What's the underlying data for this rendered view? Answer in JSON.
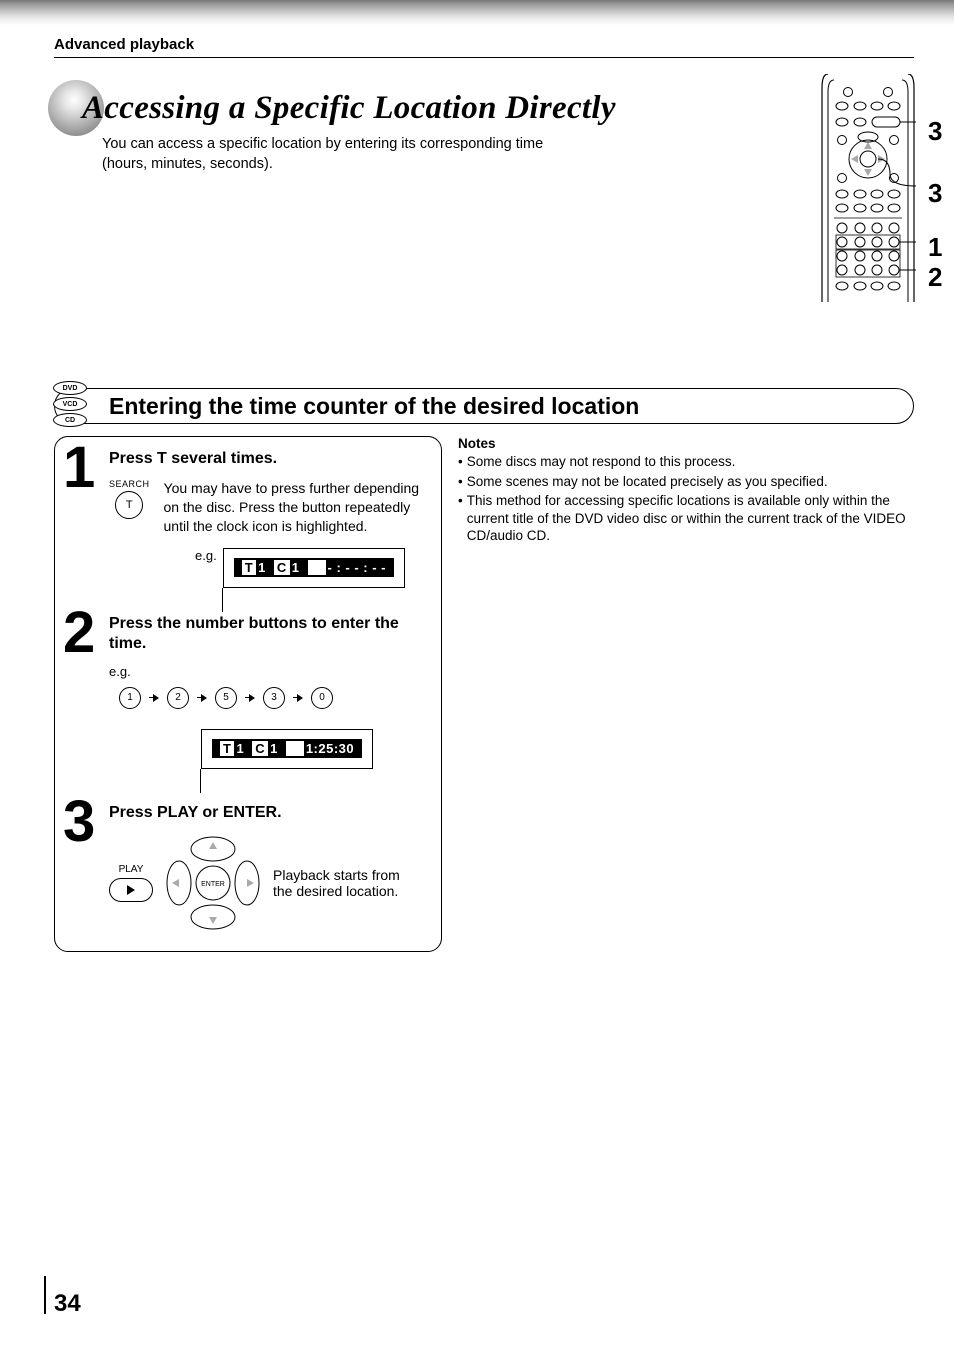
{
  "breadcrumb": "Advanced playback",
  "title": "Accessing a Specific Location Directly",
  "subtitle": "You can access a specific location by entering its corresponding time (hours, minutes, seconds).",
  "remote": {
    "callout_3a": "3",
    "callout_3b": "3",
    "callout_1": "1",
    "callout_2": "2"
  },
  "media": {
    "dvd": "DVD",
    "vcd": "VCD",
    "cd": "CD"
  },
  "section_title": "Entering the time counter of the desired location",
  "eg_label": "e.g.",
  "steps": {
    "s1": {
      "num": "1",
      "title": "Press T several times.",
      "search_label": "SEARCH",
      "t_label": "T",
      "body": "You may have to press further depending on the disc. Press the button repeatedly until the clock icon is highlighted.",
      "osd": {
        "T": "T",
        "Tn": "1",
        "C": "C",
        "Cn": "1",
        "time": "- : - - : - -"
      }
    },
    "s2": {
      "num": "2",
      "title": "Press the number buttons to enter the time.",
      "nums": [
        "1",
        "2",
        "5",
        "3",
        "0"
      ],
      "osd": {
        "T": "T",
        "Tn": "1",
        "C": "C",
        "Cn": "1",
        "time": "1:25:30"
      }
    },
    "s3": {
      "num": "3",
      "title": "Press PLAY or ENTER.",
      "play_label": "PLAY",
      "enter_label": "ENTER",
      "body": "Playback starts from the desired location."
    }
  },
  "notes": {
    "heading": "Notes",
    "items": [
      "Some discs may not respond to this process.",
      "Some scenes may not be located precisely as you specified.",
      "This method for accessing specific locations is available only within the current title of the DVD video disc or within the current track of the VIDEO CD/audio CD."
    ]
  },
  "page_number": "34"
}
